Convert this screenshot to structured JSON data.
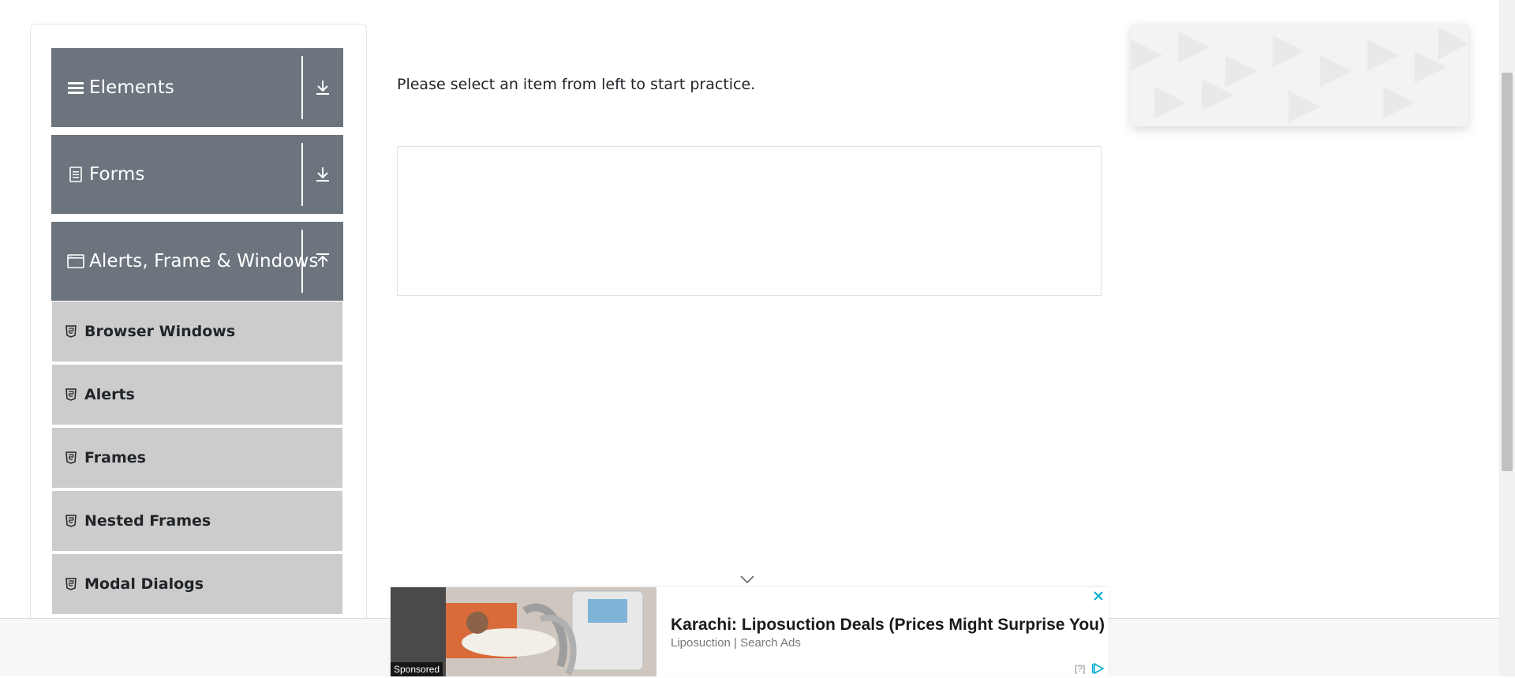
{
  "sidebar": {
    "groups": [
      {
        "label": "Elements",
        "icon": "hamburger-icon",
        "toggle": "download-icon",
        "expanded": false
      },
      {
        "label": "Forms",
        "icon": "document-icon",
        "toggle": "download-icon",
        "expanded": false
      },
      {
        "label": "Alerts, Frame & Windows",
        "icon": "window-icon",
        "toggle": "upload-icon",
        "expanded": true
      }
    ],
    "sub_items": [
      {
        "label": "Browser Windows",
        "icon": "html5-icon"
      },
      {
        "label": "Alerts",
        "icon": "html5-icon"
      },
      {
        "label": "Frames",
        "icon": "html5-icon"
      },
      {
        "label": "Nested Frames",
        "icon": "html5-icon"
      },
      {
        "label": "Modal Dialogs",
        "icon": "html5-icon"
      }
    ]
  },
  "main": {
    "intro": "Please select an item from left to start practice."
  },
  "ad": {
    "headline": "Karachi: Liposuction Deals (Prices Might Surprise You)",
    "source": "Liposuction | Search Ads",
    "sponsored": "Sponsored",
    "help": "[?]",
    "accent_color": "#00aecd"
  },
  "colors": {
    "group_header_bg": "#6c757d",
    "sub_item_bg": "#cccccc"
  }
}
